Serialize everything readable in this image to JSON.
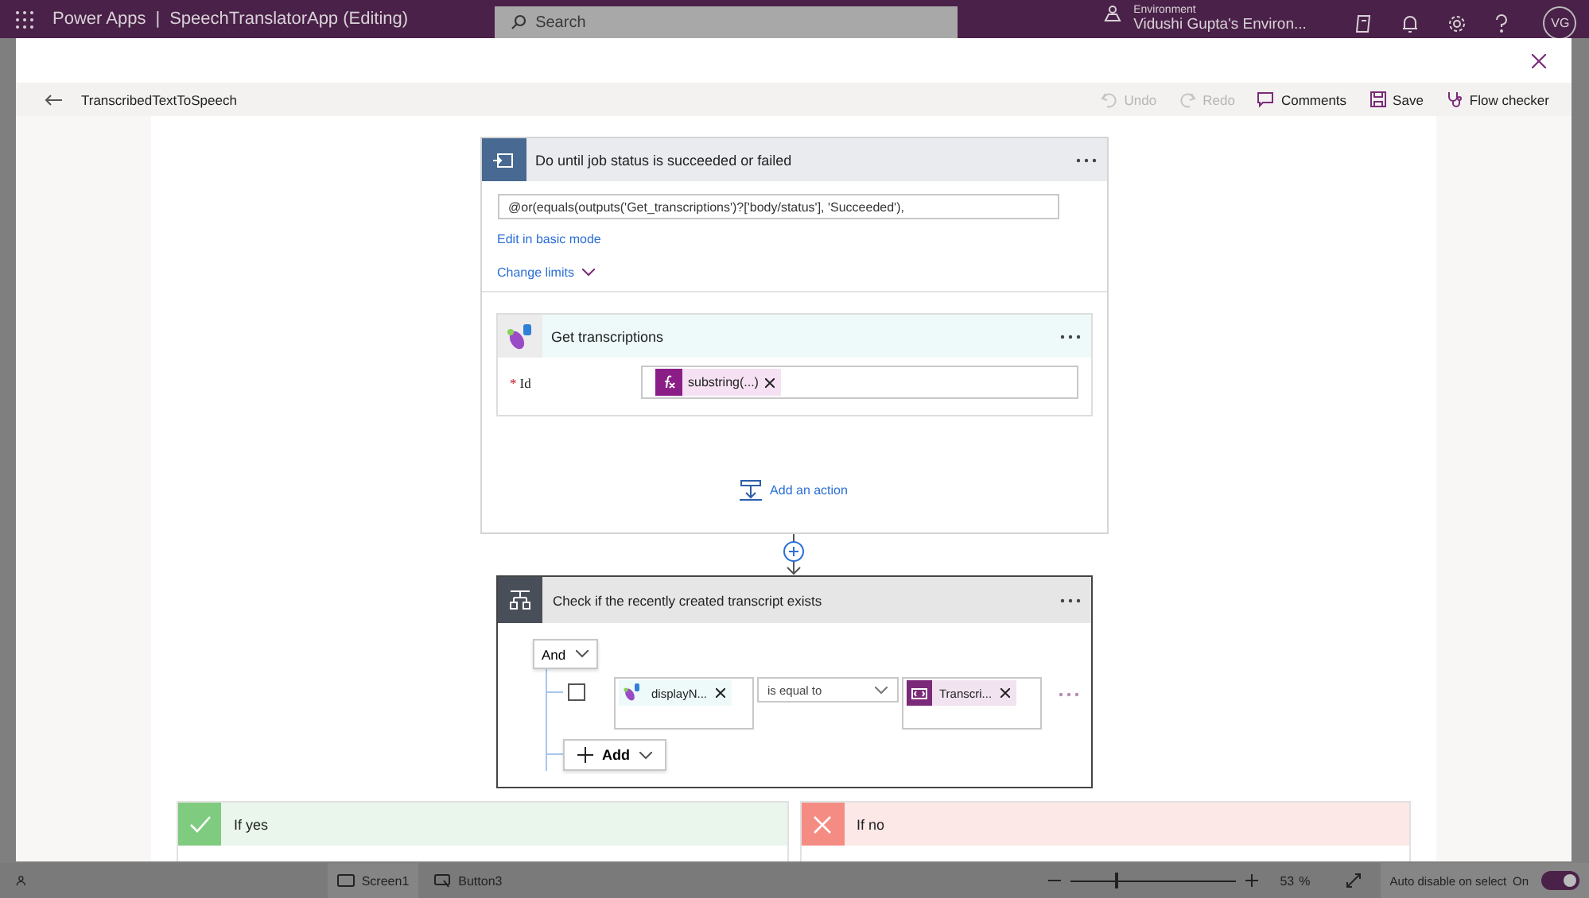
{
  "top_bar": {
    "app_name": "Power Apps",
    "separator": "|",
    "app_title": "SpeechTranslatorApp (Editing)",
    "search": {
      "placeholder": "Search"
    },
    "environment_label": "Environment",
    "environment_name": "Vidushi Gupta's Environ...",
    "avatar_initials": "VG"
  },
  "flow": {
    "name": "TranscribedTextToSpeech",
    "toolbar": [
      {
        "kind": "undo",
        "label": "Undo",
        "disabled": true
      },
      {
        "kind": "redo",
        "label": "Redo",
        "disabled": true
      },
      {
        "kind": "comments",
        "label": "Comments",
        "disabled": false
      },
      {
        "kind": "save",
        "label": "Save",
        "disabled": false
      },
      {
        "kind": "checker",
        "label": "Flow checker",
        "disabled": false
      }
    ]
  },
  "loop": {
    "title": "Do until job status is succeeded or failed",
    "expression": "@or(equals(outputs('Get_transcriptions')?['body/status'], 'Succeeded'),",
    "edit_link": "Edit in basic mode",
    "limits_link": "Change limits",
    "action": {
      "title": "Get transcriptions",
      "fields": [
        {
          "label": "Id",
          "required": true,
          "required_mark": "*",
          "token": "substring(...)"
        }
      ]
    },
    "add_action": "Add an action"
  },
  "condition": {
    "title": "Check if the recently created transcript exists",
    "operator": "And",
    "rows": [
      {
        "checked": false,
        "left_token": "displayN...",
        "comparator": "is equal to",
        "right_token": "Transcri..."
      }
    ],
    "add": "Add"
  },
  "branches": [
    {
      "kind": "yes",
      "label": "If yes"
    },
    {
      "kind": "no",
      "label": "If no"
    }
  ],
  "status_bar": {
    "screen": "Screen1",
    "control": "Button3",
    "zoom": {
      "level": 0.27,
      "value": "53",
      "unit": "%"
    },
    "property": "Auto disable on select",
    "toggle": {
      "label": "On",
      "on": true
    }
  }
}
